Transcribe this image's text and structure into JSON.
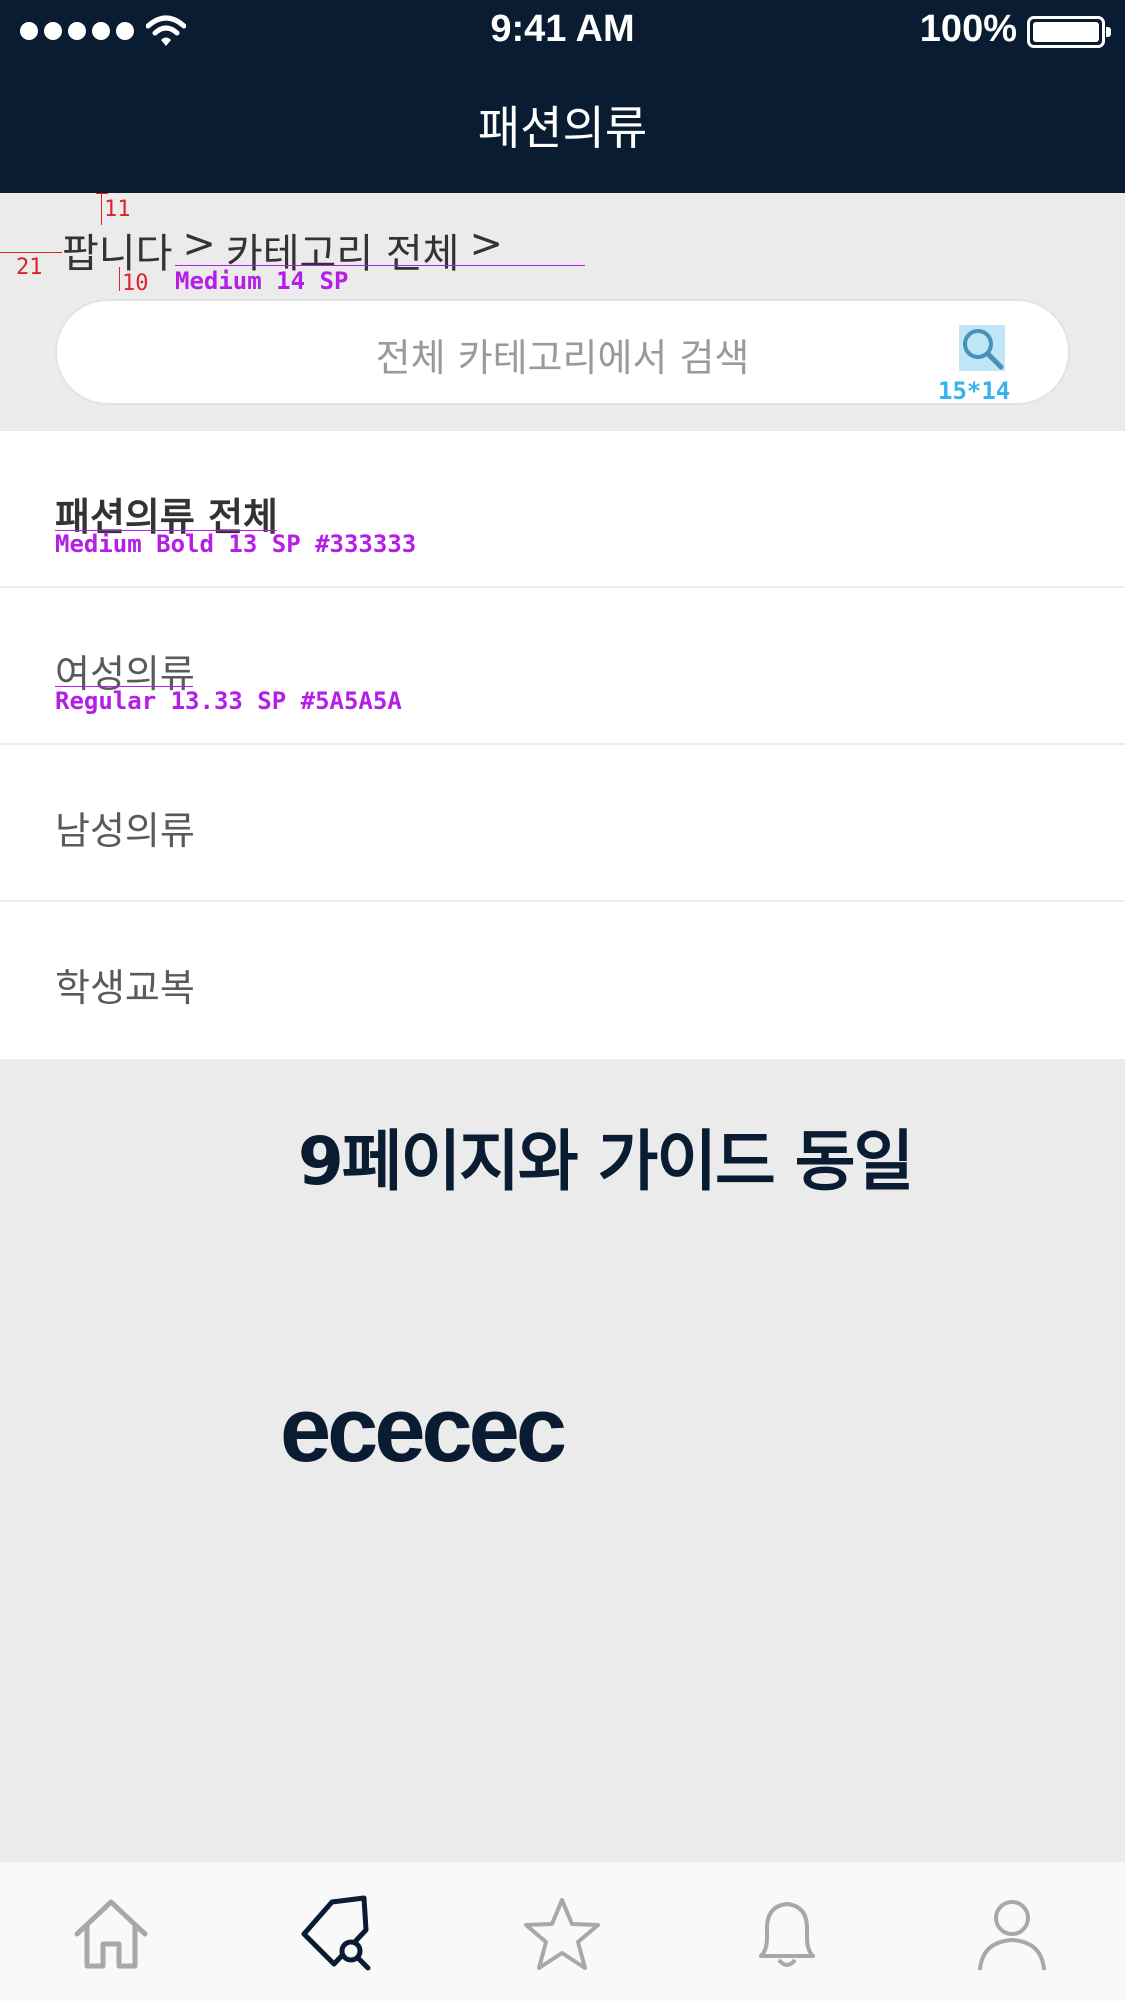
{
  "status_bar": {
    "time": "9:41 AM",
    "battery_percent": "100%",
    "signal_dots": 5
  },
  "nav": {
    "title": "패션의류"
  },
  "breadcrumb": {
    "items": [
      "팝니다",
      ">",
      "카테고리 전체",
      ">"
    ]
  },
  "annotations": {
    "top_spacing": "11",
    "left_spacing": "21",
    "below_spacing": "10",
    "breadcrumb_font": "Medium 14 SP",
    "breadcrumb_color": "#333333",
    "icon_size": "15*14",
    "active_item_font": "Medium Bold 13 SP #333333",
    "item_font": "Regular 13.33 SP #5A5A5A"
  },
  "search": {
    "placeholder": "전체 카테고리에서 검색"
  },
  "categories": [
    {
      "label": "패션의류 전체",
      "active": true
    },
    {
      "label": "여성의류",
      "active": false
    },
    {
      "label": "남성의류",
      "active": false
    },
    {
      "label": "학생교복",
      "active": false
    }
  ],
  "guide_note": "9페이지와 가이드 동일",
  "background_color_label": "ececec",
  "tab_bar": {
    "tabs": [
      {
        "icon": "home-icon"
      },
      {
        "icon": "tag-search-icon",
        "active": true
      },
      {
        "icon": "star-icon"
      },
      {
        "icon": "bell-icon"
      },
      {
        "icon": "user-icon"
      }
    ]
  },
  "colors": {
    "nav_background": "#0a1c31",
    "page_background": "#ebebeb",
    "text_primary": "#333333",
    "text_secondary": "#5a5a5a",
    "annotation_red": "#e0202a",
    "annotation_purple": "#b41ee8",
    "annotation_blue": "#35b3ea"
  }
}
